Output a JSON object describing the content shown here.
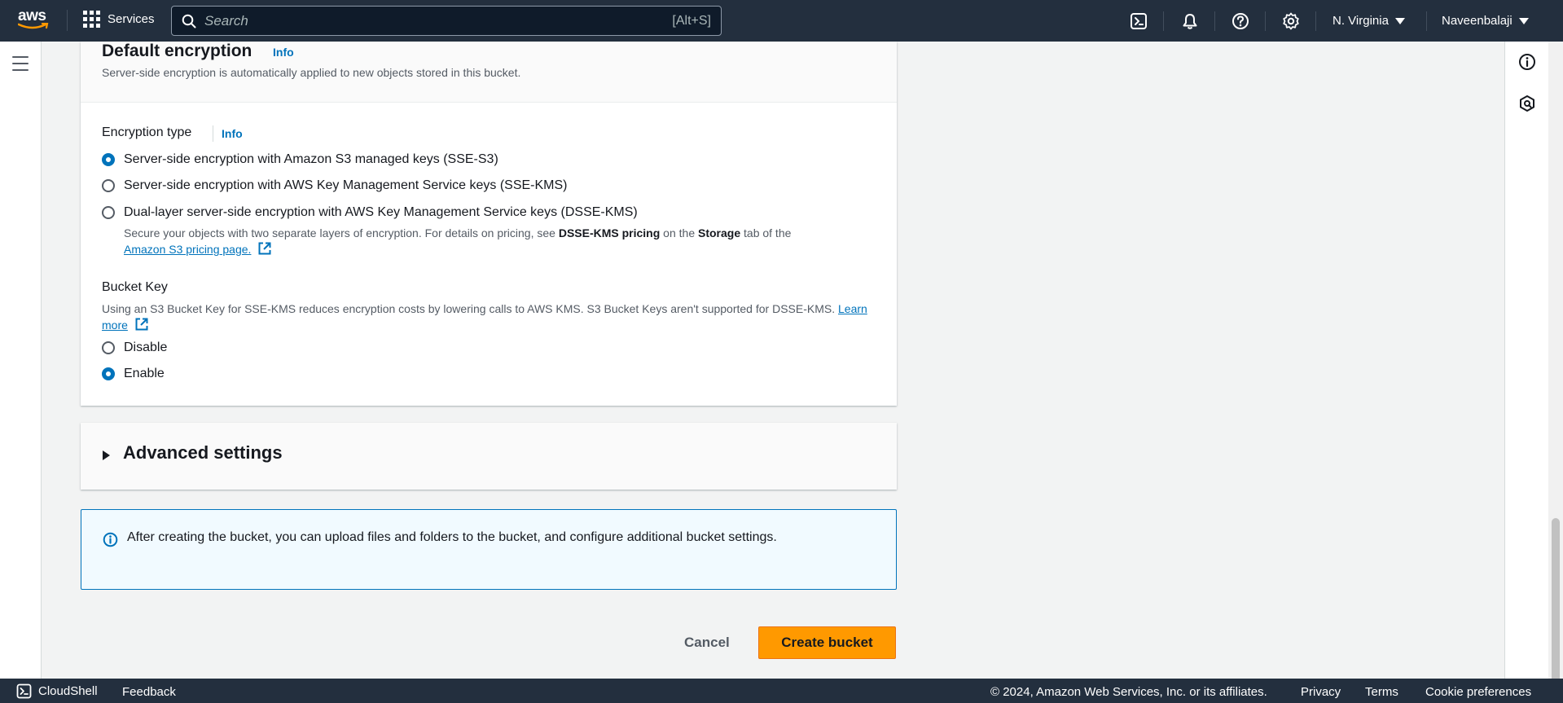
{
  "topnav": {
    "logo_text": "aws",
    "services_label": "Services",
    "search_placeholder": "Search",
    "search_shortcut": "[Alt+S]",
    "region": "N. Virginia",
    "user": "Naveenbalaji"
  },
  "encryption": {
    "title": "Default encryption",
    "info": "Info",
    "description": "Server-side encryption is automatically applied to new objects stored in this bucket.",
    "type_label": "Encryption type",
    "type_info": "Info",
    "options": [
      {
        "label": "Server-side encryption with Amazon S3 managed keys (SSE-S3)",
        "checked": true
      },
      {
        "label": "Server-side encryption with AWS Key Management Service keys (SSE-KMS)",
        "checked": false
      },
      {
        "label": "Dual-layer server-side encryption with AWS Key Management Service keys (DSSE-KMS)",
        "checked": false
      }
    ],
    "dsse_help_prefix": "Secure your objects with two separate layers of encryption. For details on pricing, see ",
    "dsse_help_bold1": "DSSE-KMS pricing",
    "dsse_help_mid": " on the ",
    "dsse_help_bold2": "Storage",
    "dsse_help_suffix": " tab of the",
    "dsse_help_link": "Amazon S3 pricing page."
  },
  "bucket_key": {
    "label": "Bucket Key",
    "help": "Using an S3 Bucket Key for SSE-KMS reduces encryption costs by lowering calls to AWS KMS. S3 Bucket Keys aren't supported for DSSE-KMS.",
    "learn_more": "Learn more",
    "options": [
      {
        "label": "Disable",
        "checked": false
      },
      {
        "label": "Enable",
        "checked": true
      }
    ]
  },
  "advanced": {
    "title": "Advanced settings"
  },
  "alert": {
    "text": "After creating the bucket, you can upload files and folders to the bucket, and configure additional bucket settings."
  },
  "actions": {
    "cancel": "Cancel",
    "create": "Create bucket"
  },
  "footer": {
    "cloudshell": "CloudShell",
    "feedback": "Feedback",
    "copyright": "© 2024, Amazon Web Services, Inc. or its affiliates.",
    "privacy": "Privacy",
    "terms": "Terms",
    "cookies": "Cookie preferences"
  },
  "colors": {
    "nav_bg": "#232f3e",
    "link": "#0073bb",
    "primary_button": "#ff9900",
    "alert_bg": "#f1faff"
  }
}
